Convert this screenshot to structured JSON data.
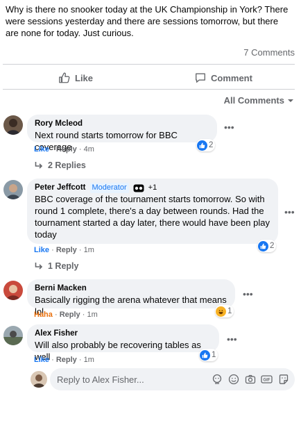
{
  "post": {
    "text": "Why is there no snooker today at the UK Championship in York?  There were sessions yesterday and there are sessions tomorrow, but there are none for today.  Just curious.",
    "comment_count": "7 Comments",
    "like_label": "Like",
    "comment_label": "Comment",
    "sort_label": "All Comments"
  },
  "comments": [
    {
      "name": "Rory Mcleod",
      "text": "Next round starts tomorrow for BBC coverage",
      "like": "Like",
      "reply": "Reply",
      "time": "4m",
      "reactions": "2",
      "replies": "2 Replies"
    },
    {
      "name": "Peter Jeffcott",
      "badge": "Moderator",
      "extra": "+1",
      "text": "BBC coverage of the tournament starts tomorrow. So with round 1 complete, there's a day between rounds. Had the tournament started a day later, there would have been play today",
      "like": "Like",
      "reply": "Reply",
      "time": "1m",
      "reactions": "2",
      "replies": "1 Reply"
    },
    {
      "name": "Berni Macken",
      "text": "Basically rigging the arena whatever that means lol",
      "like": "Haha",
      "reply": "Reply",
      "time": "1m",
      "reactions": "1"
    },
    {
      "name": "Alex Fisher",
      "text": "Will also probably be recovering tables as well",
      "like": "Like",
      "reply": "Reply",
      "time": "1m",
      "reactions": "1"
    }
  ],
  "reply_box": {
    "placeholder": "Reply to Alex Fisher..."
  },
  "colors": {
    "link_blue": "#1877f2",
    "haha_orange": "#e9710f",
    "muted": "#65676b",
    "bubble": "#f0f2f5"
  }
}
